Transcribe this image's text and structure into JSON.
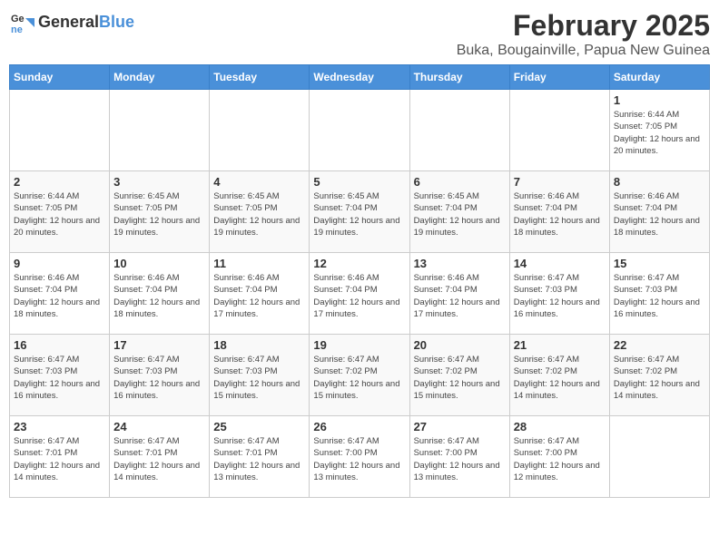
{
  "logo": {
    "general": "General",
    "blue": "Blue"
  },
  "title": "February 2025",
  "subtitle": "Buka, Bougainville, Papua New Guinea",
  "days_of_week": [
    "Sunday",
    "Monday",
    "Tuesday",
    "Wednesday",
    "Thursday",
    "Friday",
    "Saturday"
  ],
  "weeks": [
    [
      {
        "day": "",
        "info": ""
      },
      {
        "day": "",
        "info": ""
      },
      {
        "day": "",
        "info": ""
      },
      {
        "day": "",
        "info": ""
      },
      {
        "day": "",
        "info": ""
      },
      {
        "day": "",
        "info": ""
      },
      {
        "day": "1",
        "info": "Sunrise: 6:44 AM\nSunset: 7:05 PM\nDaylight: 12 hours and 20 minutes."
      }
    ],
    [
      {
        "day": "2",
        "info": "Sunrise: 6:44 AM\nSunset: 7:05 PM\nDaylight: 12 hours and 20 minutes."
      },
      {
        "day": "3",
        "info": "Sunrise: 6:45 AM\nSunset: 7:05 PM\nDaylight: 12 hours and 19 minutes."
      },
      {
        "day": "4",
        "info": "Sunrise: 6:45 AM\nSunset: 7:05 PM\nDaylight: 12 hours and 19 minutes."
      },
      {
        "day": "5",
        "info": "Sunrise: 6:45 AM\nSunset: 7:04 PM\nDaylight: 12 hours and 19 minutes."
      },
      {
        "day": "6",
        "info": "Sunrise: 6:45 AM\nSunset: 7:04 PM\nDaylight: 12 hours and 19 minutes."
      },
      {
        "day": "7",
        "info": "Sunrise: 6:46 AM\nSunset: 7:04 PM\nDaylight: 12 hours and 18 minutes."
      },
      {
        "day": "8",
        "info": "Sunrise: 6:46 AM\nSunset: 7:04 PM\nDaylight: 12 hours and 18 minutes."
      }
    ],
    [
      {
        "day": "9",
        "info": "Sunrise: 6:46 AM\nSunset: 7:04 PM\nDaylight: 12 hours and 18 minutes."
      },
      {
        "day": "10",
        "info": "Sunrise: 6:46 AM\nSunset: 7:04 PM\nDaylight: 12 hours and 18 minutes."
      },
      {
        "day": "11",
        "info": "Sunrise: 6:46 AM\nSunset: 7:04 PM\nDaylight: 12 hours and 17 minutes."
      },
      {
        "day": "12",
        "info": "Sunrise: 6:46 AM\nSunset: 7:04 PM\nDaylight: 12 hours and 17 minutes."
      },
      {
        "day": "13",
        "info": "Sunrise: 6:46 AM\nSunset: 7:04 PM\nDaylight: 12 hours and 17 minutes."
      },
      {
        "day": "14",
        "info": "Sunrise: 6:47 AM\nSunset: 7:03 PM\nDaylight: 12 hours and 16 minutes."
      },
      {
        "day": "15",
        "info": "Sunrise: 6:47 AM\nSunset: 7:03 PM\nDaylight: 12 hours and 16 minutes."
      }
    ],
    [
      {
        "day": "16",
        "info": "Sunrise: 6:47 AM\nSunset: 7:03 PM\nDaylight: 12 hours and 16 minutes."
      },
      {
        "day": "17",
        "info": "Sunrise: 6:47 AM\nSunset: 7:03 PM\nDaylight: 12 hours and 16 minutes."
      },
      {
        "day": "18",
        "info": "Sunrise: 6:47 AM\nSunset: 7:03 PM\nDaylight: 12 hours and 15 minutes."
      },
      {
        "day": "19",
        "info": "Sunrise: 6:47 AM\nSunset: 7:02 PM\nDaylight: 12 hours and 15 minutes."
      },
      {
        "day": "20",
        "info": "Sunrise: 6:47 AM\nSunset: 7:02 PM\nDaylight: 12 hours and 15 minutes."
      },
      {
        "day": "21",
        "info": "Sunrise: 6:47 AM\nSunset: 7:02 PM\nDaylight: 12 hours and 14 minutes."
      },
      {
        "day": "22",
        "info": "Sunrise: 6:47 AM\nSunset: 7:02 PM\nDaylight: 12 hours and 14 minutes."
      }
    ],
    [
      {
        "day": "23",
        "info": "Sunrise: 6:47 AM\nSunset: 7:01 PM\nDaylight: 12 hours and 14 minutes."
      },
      {
        "day": "24",
        "info": "Sunrise: 6:47 AM\nSunset: 7:01 PM\nDaylight: 12 hours and 14 minutes."
      },
      {
        "day": "25",
        "info": "Sunrise: 6:47 AM\nSunset: 7:01 PM\nDaylight: 12 hours and 13 minutes."
      },
      {
        "day": "26",
        "info": "Sunrise: 6:47 AM\nSunset: 7:00 PM\nDaylight: 12 hours and 13 minutes."
      },
      {
        "day": "27",
        "info": "Sunrise: 6:47 AM\nSunset: 7:00 PM\nDaylight: 12 hours and 13 minutes."
      },
      {
        "day": "28",
        "info": "Sunrise: 6:47 AM\nSunset: 7:00 PM\nDaylight: 12 hours and 12 minutes."
      },
      {
        "day": "",
        "info": ""
      }
    ]
  ]
}
